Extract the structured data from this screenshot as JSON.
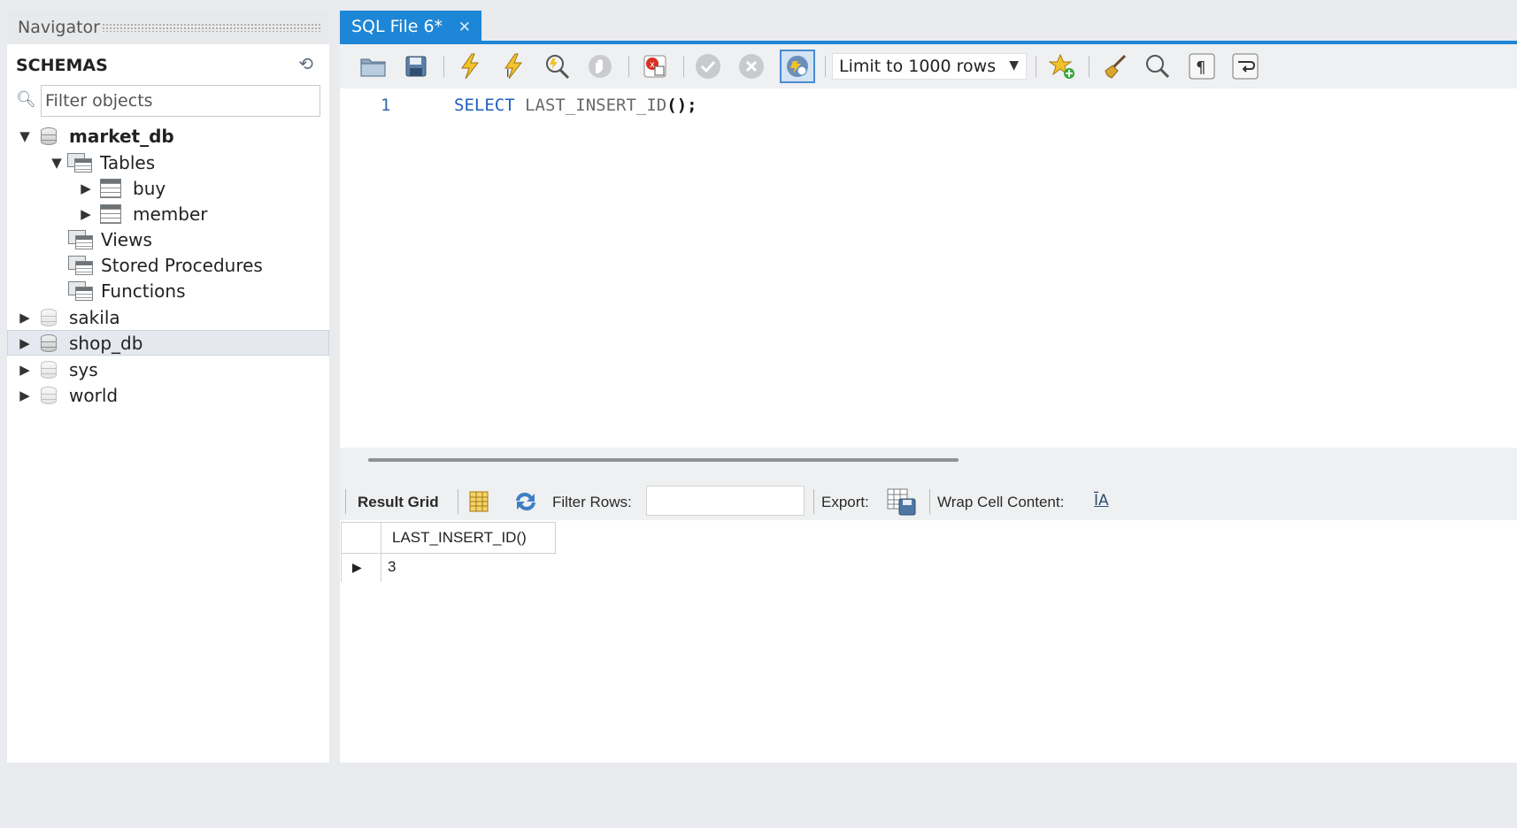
{
  "navigator": {
    "title": "Navigator",
    "schemas_label": "SCHEMAS",
    "filter_placeholder": "Filter objects",
    "tree": {
      "market_db": "market_db",
      "tables": "Tables",
      "buy": "buy",
      "member": "member",
      "views": "Views",
      "stored_procedures": "Stored Procedures",
      "functions": "Functions",
      "sakila": "sakila",
      "shop_db": "shop_db",
      "sys": "sys",
      "world": "world"
    },
    "selected": "shop_db"
  },
  "editor": {
    "tab_label": "SQL File 6*",
    "limit_select": "Limit to 1000 rows",
    "line_number": "1",
    "sql_keyword": "SELECT",
    "sql_function": "LAST_INSERT_ID",
    "sql_punct": "();"
  },
  "toolbar_icons": [
    "open-file-icon",
    "save-icon",
    "execute-icon",
    "execute-current-icon",
    "explain-icon",
    "stop-icon",
    "toggle-error-icon",
    "commit-icon",
    "rollback-icon",
    "autocommit-icon",
    "add-snippet-icon",
    "beautify-icon",
    "find-icon",
    "invisible-chars-icon",
    "wrap-lines-icon"
  ],
  "result": {
    "result_grid_label": "Result Grid",
    "filter_rows_label": "Filter Rows:",
    "export_label": "Export:",
    "wrap_label": "Wrap Cell Content:",
    "columns": [
      "LAST_INSERT_ID()"
    ],
    "rows": [
      [
        "3"
      ]
    ]
  },
  "colors": {
    "accent": "#1e86d6",
    "sql_keyword": "#1f5fbf",
    "panel_bg": "#eff0f1"
  }
}
